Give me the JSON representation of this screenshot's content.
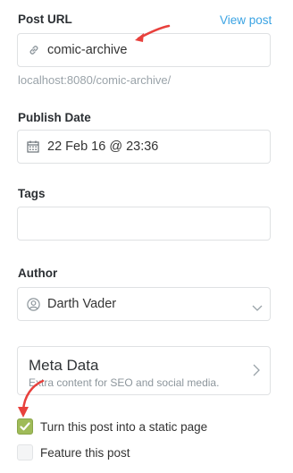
{
  "post_url": {
    "label": "Post URL",
    "view_link": "View post",
    "value": "comic-archive",
    "hint": "localhost:8080/comic-archive/"
  },
  "publish_date": {
    "label": "Publish Date",
    "value": "22 Feb 16 @ 23:36"
  },
  "tags": {
    "label": "Tags",
    "value": ""
  },
  "author": {
    "label": "Author",
    "selected": "Darth Vader"
  },
  "meta_data": {
    "title": "Meta Data",
    "subtitle": "Extra content for SEO and social media."
  },
  "options": {
    "static_page": {
      "label": "Turn this post into a static page",
      "checked": true
    },
    "feature_post": {
      "label": "Feature this post",
      "checked": false
    }
  },
  "colors": {
    "link": "#3aa3e3",
    "check_green": "#9fbb58",
    "arrow_red": "#e8403c"
  },
  "icons": [
    "link-icon",
    "calendar-icon",
    "user-icon",
    "chevron-down-icon",
    "chevron-right-icon",
    "checkmark-icon"
  ]
}
